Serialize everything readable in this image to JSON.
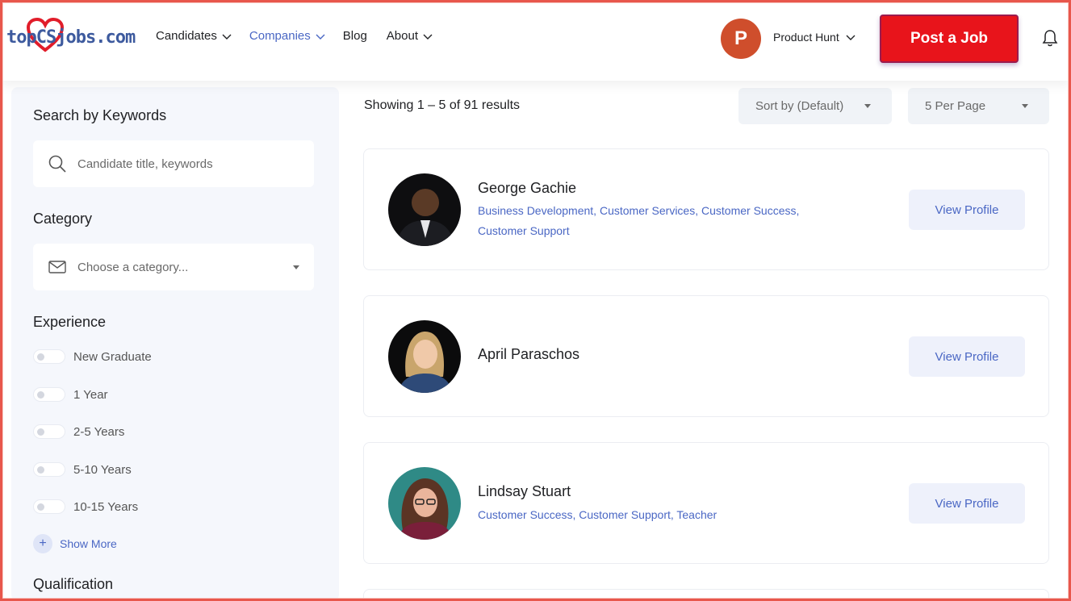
{
  "header": {
    "logo_text": "topCSjobs.com",
    "nav": [
      {
        "label": "Candidates",
        "has_dropdown": true,
        "active": false
      },
      {
        "label": "Companies",
        "has_dropdown": true,
        "active": true
      },
      {
        "label": "Blog",
        "has_dropdown": false,
        "active": false
      },
      {
        "label": "About",
        "has_dropdown": true,
        "active": false
      }
    ],
    "company_avatar_letter": "P",
    "company_name": "Product Hunt",
    "post_job_label": "Post a Job",
    "bell_icon": "bell-icon"
  },
  "sidebar": {
    "search_heading": "Search by Keywords",
    "search_placeholder": "Candidate title, keywords",
    "category_heading": "Category",
    "category_placeholder": "Choose a category...",
    "experience_heading": "Experience",
    "experience_options": [
      "New Graduate",
      "1 Year",
      "2-5 Years",
      "5-10 Years",
      "10-15 Years"
    ],
    "show_more_label": "Show More",
    "qualification_heading": "Qualification"
  },
  "results": {
    "count_text": "Showing 1 – 5 of 91 results",
    "sort_label": "Sort by (Default)",
    "per_page_label": "5 Per Page"
  },
  "candidates": [
    {
      "name": "George Gachie",
      "tags_line1": "Business Development, Customer Services, Customer Success,",
      "tags_line2": "Customer Support",
      "view_label": "View Profile"
    },
    {
      "name": "April Paraschos",
      "tags_line1": "",
      "tags_line2": "",
      "view_label": "View Profile"
    },
    {
      "name": "Lindsay Stuart",
      "tags_line1": "Customer Success, Customer Support, Teacher",
      "tags_line2": "",
      "view_label": "View Profile"
    }
  ],
  "colors": {
    "accent": "#4a67c4",
    "post_job_bg": "#e8141b",
    "sidebar_bg": "#f5f7fc",
    "frame": "#e8574c"
  }
}
